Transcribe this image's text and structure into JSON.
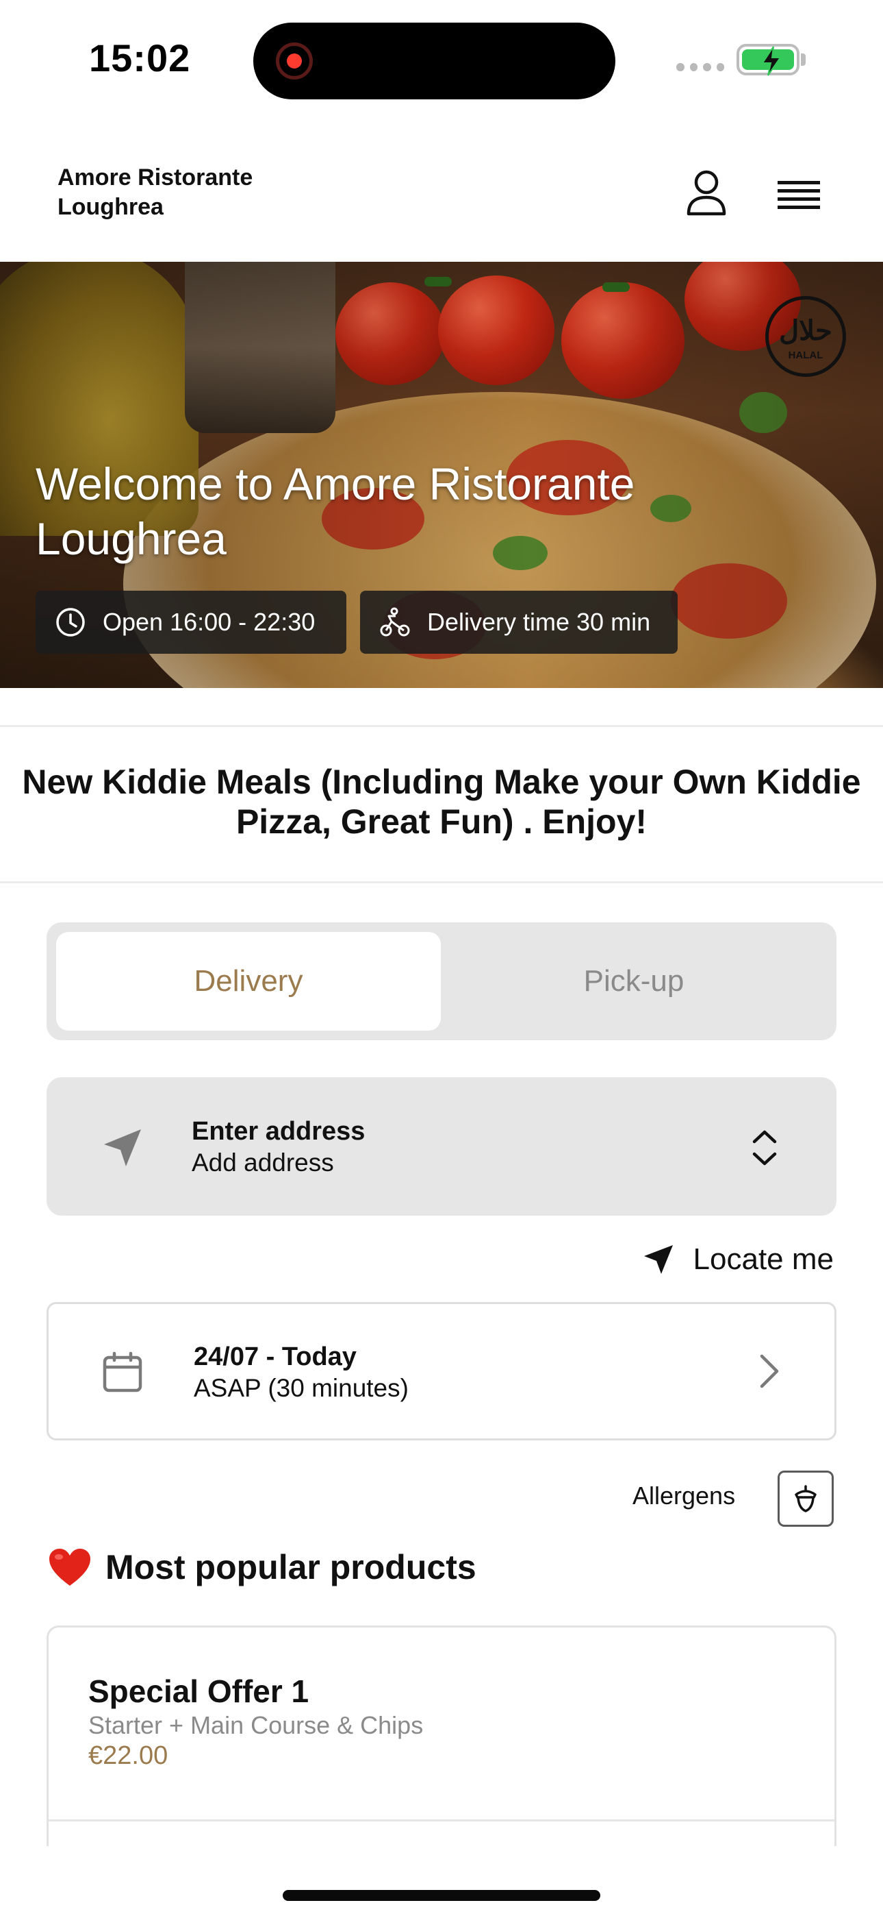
{
  "status_bar": {
    "time": "15:02"
  },
  "header": {
    "restaurant_name": "Amore Ristorante Loughrea"
  },
  "hero": {
    "title": "Welcome to Amore Ristorante Loughrea",
    "opening_hours": "Open 16:00 - 22:30",
    "delivery_time": "Delivery time 30 min",
    "badge_text": "HALAL",
    "badge_arabic": "حلال"
  },
  "announcement": "New Kiddie Meals (Including Make your Own Kiddie Pizza, Great Fun) . Enjoy!",
  "order_mode": {
    "tabs": [
      "Delivery",
      "Pick-up"
    ],
    "selected": "Delivery"
  },
  "address": {
    "title": "Enter address",
    "subtitle": "Add address"
  },
  "locate_me": "Locate me",
  "schedule": {
    "date": "24/07 - Today",
    "time": "ASAP (30 minutes)"
  },
  "allergens_label": "Allergens",
  "popular": {
    "title": "Most popular products",
    "products": [
      {
        "name": "Special Offer 1",
        "description": "Starter + Main Course & Chips",
        "price": "€22.00"
      }
    ]
  },
  "colors": {
    "accent": "#9b7b4e",
    "segment_bg": "#e6e6e6",
    "battery": "#34c759"
  }
}
